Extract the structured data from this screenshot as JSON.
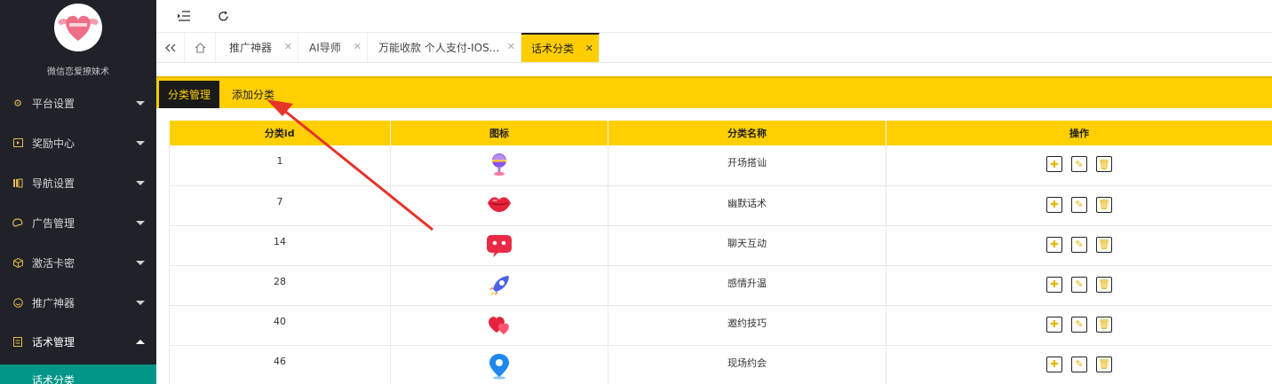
{
  "sidebar": {
    "brand": "微信恋爱撩妹术",
    "items": [
      {
        "label": "平台设置",
        "icon": "gear-icon"
      },
      {
        "label": "奖励中心",
        "icon": "play-icon"
      },
      {
        "label": "导航设置",
        "icon": "nav-icon"
      },
      {
        "label": "广告管理",
        "icon": "palette-icon"
      },
      {
        "label": "激活卡密",
        "icon": "cube-icon"
      },
      {
        "label": "推广神器",
        "icon": "smile-icon"
      },
      {
        "label": "话术管理",
        "icon": "doc-icon"
      }
    ],
    "sub_item": "话术分类"
  },
  "tabs": [
    {
      "label": "推广神器"
    },
    {
      "label": "AI导师"
    },
    {
      "label": "万能收款 个人支付-IOS..."
    },
    {
      "label": "话术分类"
    }
  ],
  "subtabs": {
    "manage": "分类管理",
    "add": "添加分类"
  },
  "table": {
    "headers": [
      "分类id",
      "图标",
      "分类名称",
      "操作"
    ],
    "rows": [
      {
        "id": "1",
        "name": "开场搭讪",
        "icon": "lollipop-icon"
      },
      {
        "id": "7",
        "name": "幽默话术",
        "icon": "lips-icon"
      },
      {
        "id": "14",
        "name": "聊天互动",
        "icon": "chat-bubble-icon"
      },
      {
        "id": "28",
        "name": "感情升温",
        "icon": "rocket-icon"
      },
      {
        "id": "40",
        "name": "邀约技巧",
        "icon": "hearts-icon"
      },
      {
        "id": "46",
        "name": "现场约会",
        "icon": "location-pin-icon"
      }
    ]
  },
  "colors": {
    "accent": "#ffcf00",
    "sidebar": "#20222a",
    "active_sub": "#009688",
    "arrow": "#e8332a"
  }
}
